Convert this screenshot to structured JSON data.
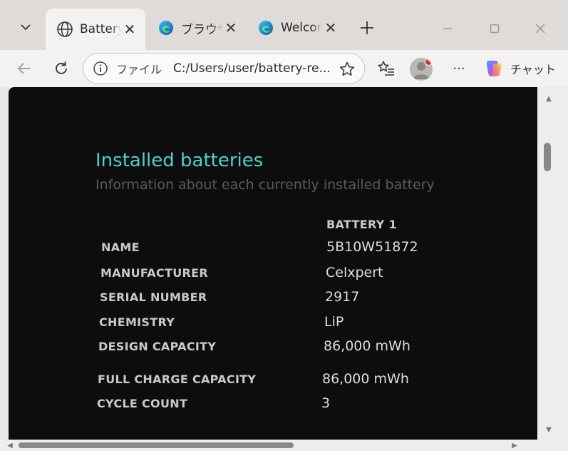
{
  "tabs": [
    {
      "title": "Battery",
      "icon": "globe-icon",
      "active": true
    },
    {
      "title": "ブラウザー",
      "icon": "edge-icon",
      "active": false
    },
    {
      "title": "Welcome",
      "icon": "edge-icon",
      "active": false
    }
  ],
  "toolbar": {
    "address_scheme": "ファイル",
    "address_url": "C:/Users/user/battery-re...",
    "copilot_label": "チャット",
    "more_label": "···"
  },
  "report": {
    "title": "Installed batteries",
    "subtitle": "Information about each currently installed battery",
    "column_header": "BATTERY 1",
    "rows": [
      {
        "label": "NAME",
        "value": "5B10W51872"
      },
      {
        "label": "MANUFACTURER",
        "value": "Celxpert"
      },
      {
        "label": "SERIAL NUMBER",
        "value": "2917"
      },
      {
        "label": "CHEMISTRY",
        "value": "LiP"
      },
      {
        "label": "DESIGN CAPACITY",
        "value": "86,000 mWh"
      },
      {
        "label": "FULL CHARGE CAPACITY",
        "value": "86,000 mWh"
      },
      {
        "label": "CYCLE COUNT",
        "value": "3"
      }
    ]
  },
  "colors": {
    "title_accent": "#4fd1c9",
    "page_background": "#0d0d0d",
    "profile_badge": "#d9342b"
  }
}
